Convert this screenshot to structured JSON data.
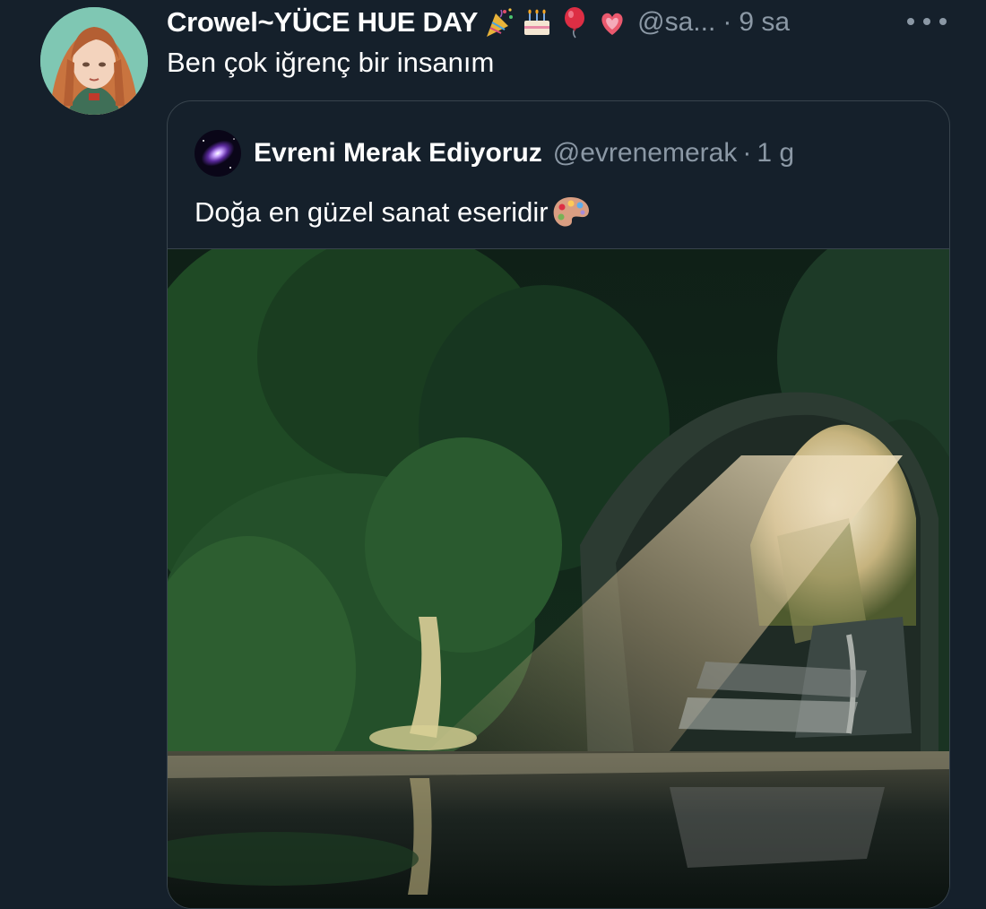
{
  "tweet": {
    "display_name": "Crowel~YÜCE HUE DAY",
    "name_emojis": [
      "party-popper-icon",
      "birthday-cake-icon",
      "balloon-icon",
      "sparkling-heart-icon"
    ],
    "handle": "@sa...",
    "separator": "·",
    "time": "9 sa",
    "text": "Ben çok iğrenç bir insanım"
  },
  "quote": {
    "display_name": "Evreni Merak Ediyoruz",
    "handle": "@evrenemerak",
    "separator": "·",
    "time": "1 g",
    "text": "Doğa en güzel sanat eseridir",
    "text_emoji": "artist-palette-icon"
  },
  "colors": {
    "background": "#15202b",
    "text_primary": "#ffffff",
    "text_secondary": "#8b98a5",
    "border": "#38444d"
  }
}
